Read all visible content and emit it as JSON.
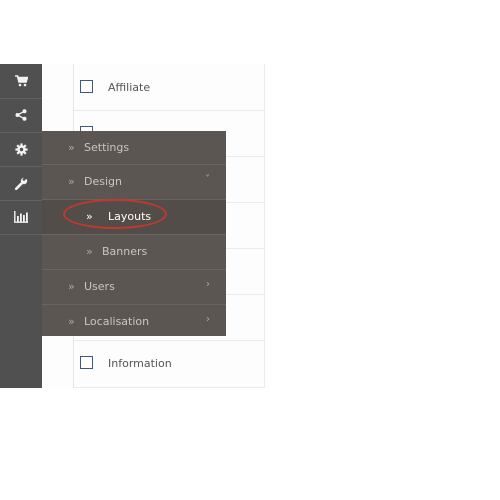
{
  "sidebar": {
    "icons": [
      "cart-icon",
      "share-icon",
      "gear-icon",
      "wrench-icon",
      "bar-chart-icon"
    ]
  },
  "content_rows": [
    {
      "label": "Affiliate"
    },
    {
      "label": "Information"
    }
  ],
  "menu": {
    "chevron": "»",
    "submenu_arrow_down": "˅",
    "submenu_arrow_right": "›",
    "items": [
      {
        "label": "Settings"
      },
      {
        "label": "Design"
      },
      {
        "label": "Layouts"
      },
      {
        "label": "Banners"
      },
      {
        "label": "Users"
      },
      {
        "label": "Localisation"
      }
    ]
  },
  "colors": {
    "sidebar_bg": "#505050",
    "flyout_bg": "#5b5652",
    "highlight_oval": "#c0392b",
    "checkbox_border": "#3d5a7a"
  }
}
